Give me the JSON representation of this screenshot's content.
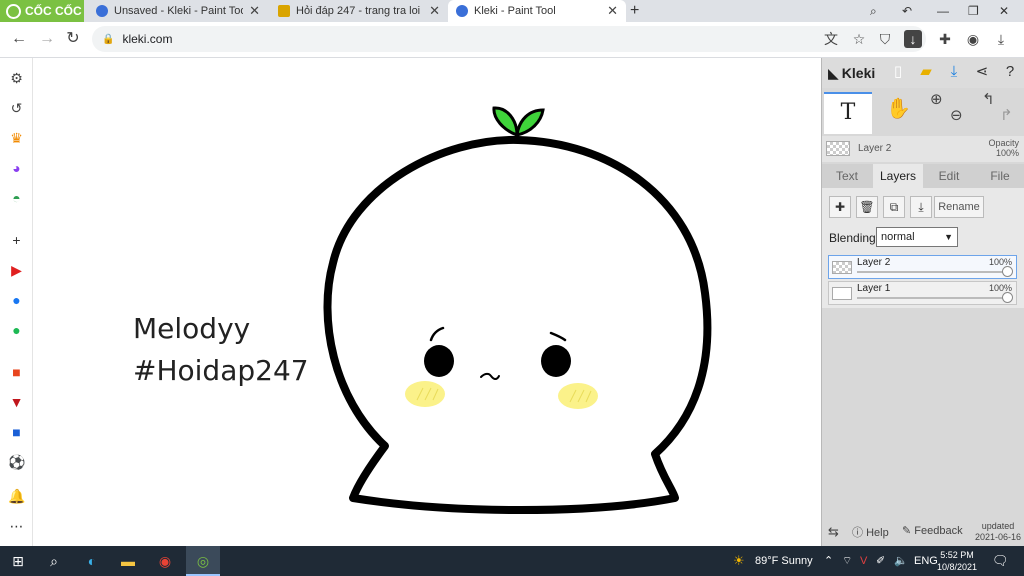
{
  "browser": {
    "brand": "CỐC CỐC",
    "tabs": [
      {
        "title": "Unsaved - Kleki - Paint Tool",
        "active": false
      },
      {
        "title": "Hỏi đáp 247 - trang tra loi",
        "active": false
      },
      {
        "title": "Kleki - Paint Tool",
        "active": true
      }
    ],
    "close_glyph": "✕",
    "new_tab_glyph": "+",
    "url": "kleki.com"
  },
  "colors": {
    "brand_green": "#7bc142",
    "panel_bg": "#d8d8d8",
    "accent_blue": "#4a8fe8",
    "sprout_green": "#3fd43a",
    "cheek_yellow": "#fbf28a",
    "taskbar_bg": "#1f2a36"
  },
  "sidebar_icons": [
    "gear-icon",
    "history-icon",
    "crown-icon",
    "messenger-icon",
    "game-icon",
    "add-icon",
    "youtube-icon",
    "facebook-icon",
    "spotify-icon",
    "shop-icon",
    "vtv-icon",
    "tiki-icon",
    "football-icon",
    "bell-icon",
    "more-icon"
  ],
  "canvas": {
    "text_line_1": "Melodyy",
    "text_line_2": "#Hoidap247"
  },
  "kleki": {
    "logo": "Kleki",
    "tool_t": "T",
    "layer_header_name": "Layer 2",
    "opacity_label": "Opacity",
    "opacity_value": "100%",
    "tabs": [
      "Text",
      "Layers",
      "Edit",
      "File"
    ],
    "active_tab": "Layers",
    "rename": "Rename",
    "blending_label": "Blending",
    "blending_value": "normal",
    "layers": [
      {
        "name": "Layer 2",
        "opacity": "100%",
        "selected": true
      },
      {
        "name": "Layer 1",
        "opacity": "100%",
        "selected": false
      }
    ],
    "help": "Help",
    "feedback": "Feedback",
    "updated_label": "updated",
    "updated_date": "2021-06-16"
  },
  "taskbar": {
    "weather": "89°F  Sunny",
    "lang": "ENG",
    "time": "5:52 PM",
    "date": "10/8/2021"
  }
}
